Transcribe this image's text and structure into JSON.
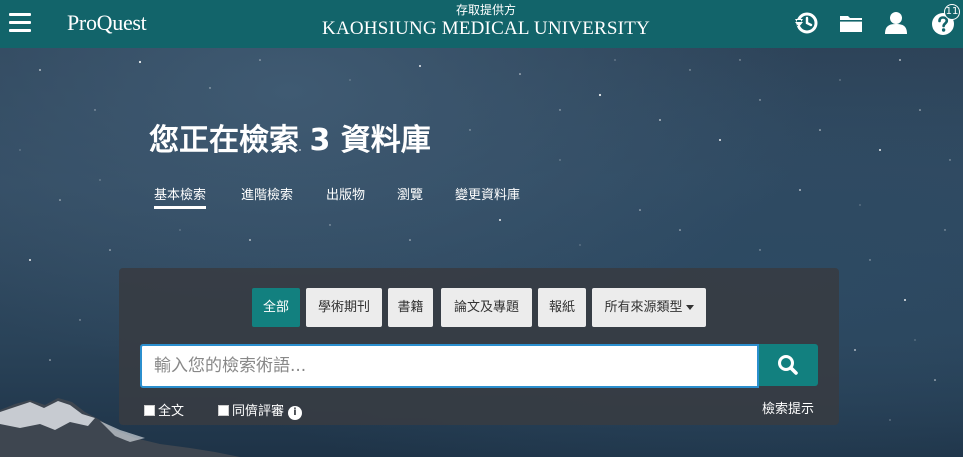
{
  "header": {
    "logo": "ProQuest",
    "provider_label": "存取提供方",
    "provider_name": "KAOHSIUNG MEDICAL UNIVERSITY",
    "help_badge": "11"
  },
  "hero": {
    "title": "您正在檢索 3 資料庫"
  },
  "nav": {
    "items": [
      {
        "label": "基本檢索"
      },
      {
        "label": "進階檢索"
      },
      {
        "label": "出版物"
      },
      {
        "label": "瀏覽"
      },
      {
        "label": "變更資料庫"
      }
    ]
  },
  "search": {
    "chips": [
      {
        "label": "全部"
      },
      {
        "label": "學術期刊"
      },
      {
        "label": "書籍"
      },
      {
        "label": "論文及專題"
      },
      {
        "label": "報紙"
      },
      {
        "label": "所有來源類型"
      }
    ],
    "placeholder": "輸入您的檢索術語...",
    "full_text_label": "全文",
    "peer_reviewed_label": "同儕評審",
    "info_glyph": "i",
    "tips_label": "檢索提示"
  },
  "colors": {
    "header_bg": "#12646a",
    "accent": "#12807f",
    "input_border": "#2b8fce"
  }
}
